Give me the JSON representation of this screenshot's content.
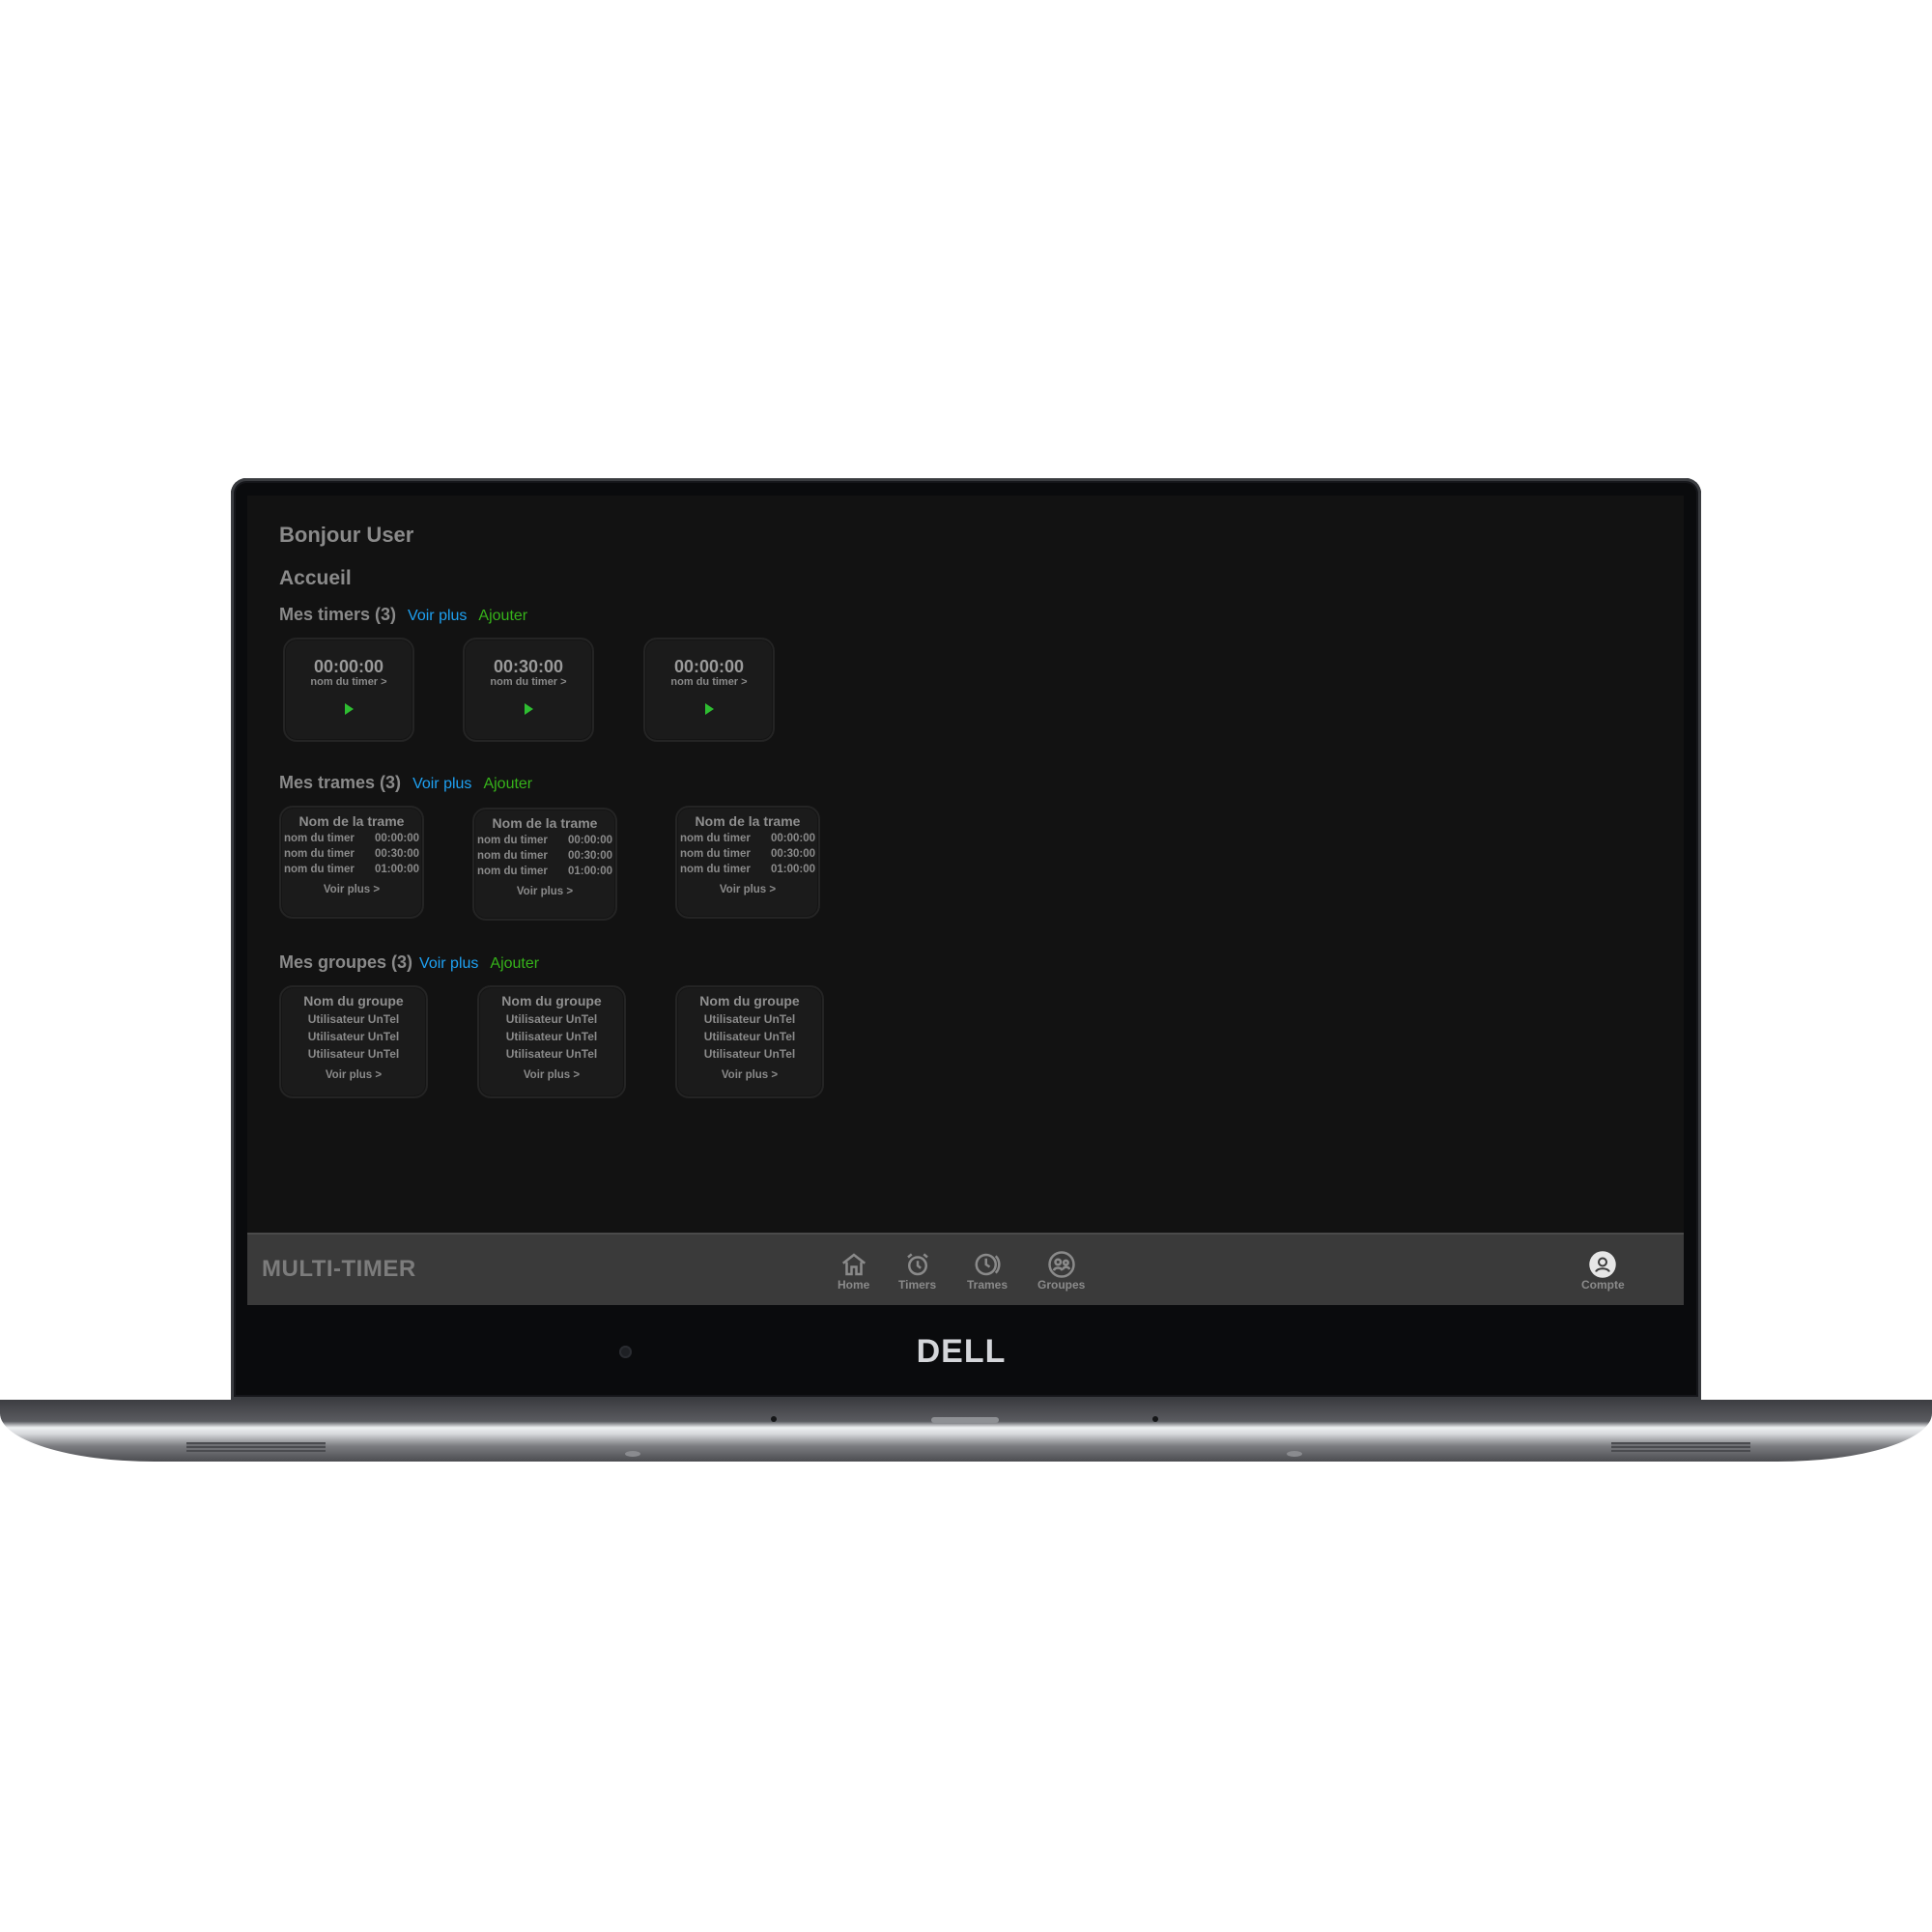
{
  "device": {
    "brand": "DELL"
  },
  "header": {
    "greeting": "Bonjour User",
    "page_title": "Accueil"
  },
  "sections": {
    "timers": {
      "title": "Mes timers (3)",
      "more": "Voir plus",
      "add": "Ajouter",
      "items": [
        {
          "time": "00:00:00",
          "name": "nom du timer >"
        },
        {
          "time": "00:30:00",
          "name": "nom du timer >"
        },
        {
          "time": "00:00:00",
          "name": "nom du timer >"
        }
      ]
    },
    "trames": {
      "title": "Mes trames (3)",
      "more": "Voir plus",
      "add": "Ajouter",
      "items": [
        {
          "name": "Nom de la trame",
          "rows": [
            {
              "label": "nom du timer",
              "time": "00:00:00"
            },
            {
              "label": "nom du timer",
              "time": "00:30:00"
            },
            {
              "label": "nom du timer",
              "time": "01:00:00"
            }
          ],
          "more": "Voir plus >"
        },
        {
          "name": "Nom de la trame",
          "rows": [
            {
              "label": "nom du timer",
              "time": "00:00:00"
            },
            {
              "label": "nom du timer",
              "time": "00:30:00"
            },
            {
              "label": "nom du timer",
              "time": "01:00:00"
            }
          ],
          "more": "Voir plus >"
        },
        {
          "name": "Nom de la trame",
          "rows": [
            {
              "label": "nom du timer",
              "time": "00:00:00"
            },
            {
              "label": "nom du timer",
              "time": "00:30:00"
            },
            {
              "label": "nom du timer",
              "time": "01:00:00"
            }
          ],
          "more": "Voir plus >"
        }
      ]
    },
    "groupes": {
      "title": "Mes groupes (3)",
      "more": "Voir plus",
      "add": "Ajouter",
      "items": [
        {
          "name": "Nom du groupe",
          "members": [
            "Utilisateur UnTel",
            "Utilisateur UnTel",
            "Utilisateur UnTel"
          ],
          "more": "Voir plus >"
        },
        {
          "name": "Nom du groupe",
          "members": [
            "Utilisateur UnTel",
            "Utilisateur UnTel",
            "Utilisateur UnTel"
          ],
          "more": "Voir plus >"
        },
        {
          "name": "Nom du groupe",
          "members": [
            "Utilisateur UnTel",
            "Utilisateur UnTel",
            "Utilisateur UnTel"
          ],
          "more": "Voir plus >"
        }
      ]
    }
  },
  "navbar": {
    "brand": "MULTI-TIMER",
    "items": [
      {
        "label": "Home",
        "icon": "home-icon"
      },
      {
        "label": "Timers",
        "icon": "alarm-clock-icon"
      },
      {
        "label": "Trames",
        "icon": "history-clock-icon"
      },
      {
        "label": "Groupes",
        "icon": "group-icon"
      }
    ],
    "account": {
      "label": "Compte",
      "icon": "user-icon"
    }
  },
  "colors": {
    "link_blue": "#1ea1f2",
    "add_green": "#36b31a",
    "play_green": "#2ebd31",
    "screen_bg": "#121212",
    "navbar_bg": "#3a3a3a"
  }
}
